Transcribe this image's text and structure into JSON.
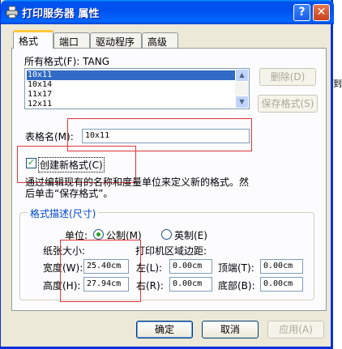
{
  "window": {
    "title": "打印服务器 属性",
    "help_glyph": "?",
    "close_glyph": "✕",
    "colors": {
      "titlebar": "#0058ee",
      "face": "#ece9d8",
      "selection": "#316ac5",
      "annotation": "#e0373a"
    }
  },
  "tabs": [
    {
      "label": "格式",
      "active": true
    },
    {
      "label": "端口",
      "active": false
    },
    {
      "label": "驱动程序",
      "active": false
    },
    {
      "label": "高级",
      "active": false
    }
  ],
  "forms_label": "所有格式(F): TANG",
  "forms_list": [
    "10x11",
    "10x14",
    "11x17",
    "12x11"
  ],
  "selected_form": "10x11",
  "buttons": {
    "delete": "删除(D)",
    "save_form": "保存格式(S)",
    "ok": "确定",
    "cancel": "取消",
    "apply": "应用(A)"
  },
  "form_name": {
    "label": "表格名(M):",
    "value": "10x11"
  },
  "create_new": {
    "label": "创建新格式(C)",
    "checked": true,
    "check_glyph": "✓"
  },
  "description": {
    "line1": "通过编辑现有的名称和度量单位来定义新的格式。然",
    "line2": "后单击“保存格式”。"
  },
  "measurements": {
    "group_title": "格式描述(尺寸)",
    "units_label": "单位:",
    "metric_label": "公制(M)",
    "english_label": "英制(E)",
    "metric_selected": true,
    "paper_size_label": "纸张大小:",
    "margins_label": "打印机区域边距:",
    "width": {
      "label": "宽度(W):",
      "value": "25.40cm"
    },
    "height": {
      "label": "高度(H):",
      "value": "27.94cm"
    },
    "left": {
      "label": "左(L):",
      "value": "0.00cm"
    },
    "right": {
      "label": "右(R):",
      "value": "0.00cm"
    },
    "top": {
      "label": "顶端(T):",
      "value": "0.00cm"
    },
    "bottom": {
      "label": "底部(B):",
      "value": "0.00cm"
    }
  },
  "background_text": "到",
  "scroll_up_glyph": "▲",
  "scroll_down_glyph": "▼"
}
